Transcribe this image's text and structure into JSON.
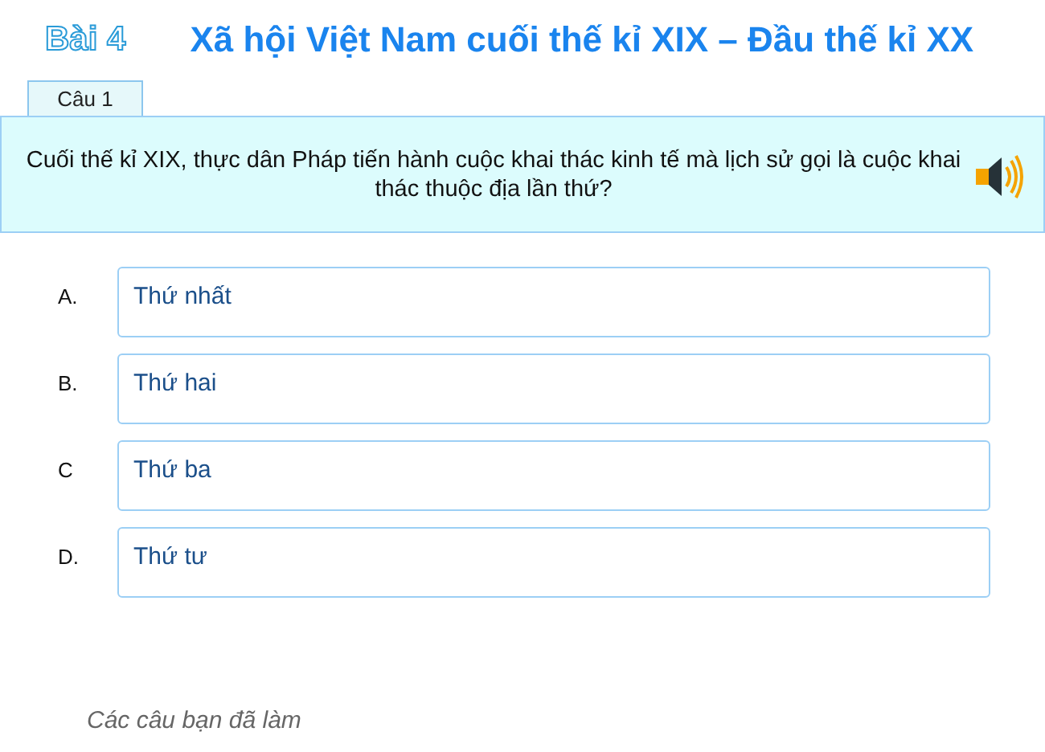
{
  "lesson": {
    "number": "Bài 4",
    "title": "Xã hội Việt Nam cuối thế kỉ XIX – Đầu thế kỉ XX"
  },
  "question": {
    "tab": "Câu 1",
    "text": "Cuối thế kỉ XIX, thực dân Pháp tiến hành cuộc khai thác kinh tế mà lịch sử gọi là cuộc khai thác thuộc địa lần thứ?"
  },
  "answers": [
    {
      "letter": "A.",
      "text": "Thứ nhất",
      "selected": false
    },
    {
      "letter": "B.",
      "text": "Thứ hai",
      "selected": false
    },
    {
      "letter": "C",
      "text": "Thứ ba",
      "selected": false
    },
    {
      "letter": "D.",
      "text": "Thứ tư",
      "selected": false
    }
  ],
  "footer": {
    "text": "Các câu bạn đã làm"
  }
}
